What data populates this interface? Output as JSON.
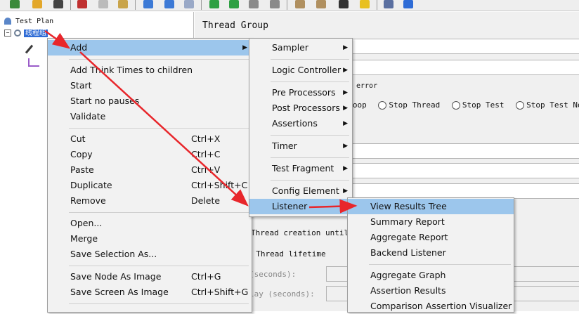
{
  "tree": {
    "test_plan": "Test Plan",
    "thread_group": "线程组"
  },
  "panel": {
    "title": "Thread Group",
    "error_label": "error",
    "radios": [
      "d Loop",
      "Stop Thread",
      "Stop Test",
      "Stop Test Now"
    ],
    "thread_creation": "Thread creation until n",
    "thread_lifetime": "y Thread lifetime",
    "duration_label": "(seconds):",
    "delay_label": "lay (seconds):"
  },
  "context_menu": {
    "items": [
      {
        "label": "Add",
        "submenu": true,
        "highlighted": true
      },
      {
        "label": "Add Think Times to children"
      },
      {
        "label": "Start"
      },
      {
        "label": "Start no pauses"
      },
      {
        "label": "Validate"
      },
      {
        "label": "Cut",
        "shortcut": "Ctrl+X"
      },
      {
        "label": "Copy",
        "shortcut": "Ctrl+C"
      },
      {
        "label": "Paste",
        "shortcut": "Ctrl+V"
      },
      {
        "label": "Duplicate",
        "shortcut": "Ctrl+Shift+C"
      },
      {
        "label": "Remove",
        "shortcut": "Delete"
      },
      {
        "label": "Open..."
      },
      {
        "label": "Merge"
      },
      {
        "label": "Save Selection As..."
      },
      {
        "label": "Save Node As Image",
        "shortcut": "Ctrl+G"
      },
      {
        "label": "Save Screen As Image",
        "shortcut": "Ctrl+Shift+G"
      }
    ]
  },
  "add_submenu": {
    "items": [
      {
        "label": "Sampler"
      },
      {
        "label": "Logic Controller"
      },
      {
        "label": "Pre Processors"
      },
      {
        "label": "Post Processors"
      },
      {
        "label": "Assertions"
      },
      {
        "label": "Timer"
      },
      {
        "label": "Test Fragment"
      },
      {
        "label": "Config Element"
      },
      {
        "label": "Listener",
        "highlighted": true
      }
    ]
  },
  "listener_submenu": {
    "items": [
      {
        "label": "View Results Tree",
        "highlighted": true
      },
      {
        "label": "Summary Report"
      },
      {
        "label": "Aggregate Report"
      },
      {
        "label": "Backend Listener"
      },
      {
        "label": "Aggregate Graph"
      },
      {
        "label": "Assertion Results"
      },
      {
        "label": "Comparison Assertion Visualizer"
      }
    ]
  },
  "colors": {
    "highlight": "#9cc6ec",
    "selection": "#2f6cd6",
    "annotation_arrow": "#e8262b"
  }
}
